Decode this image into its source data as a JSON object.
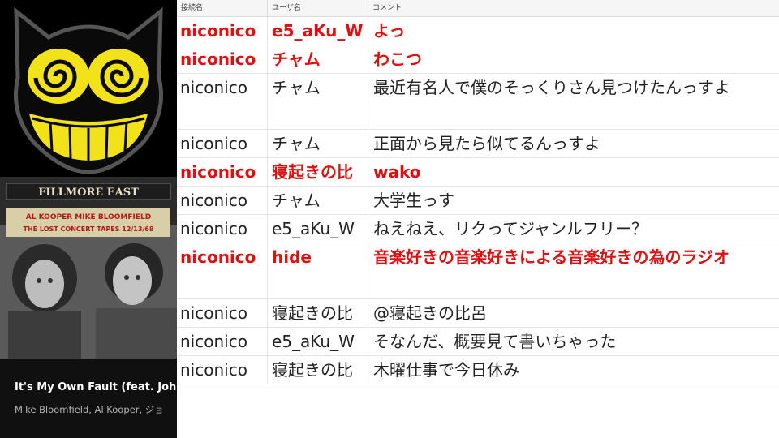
{
  "table": {
    "headers": [
      "接続名",
      "ユーザ名",
      "コメント"
    ],
    "rows": [
      {
        "conn": "niconico",
        "user": "e5_aKu_W",
        "comment": "よっ",
        "highlight": true
      },
      {
        "conn": "niconico",
        "user": "チャム",
        "comment": "わこつ",
        "highlight": true
      },
      {
        "conn": "niconico",
        "user": "チャム",
        "comment": "最近有名人で僕のそっくりさん見つけたんっすよ",
        "highlight": false
      },
      {
        "conn": "niconico",
        "user": "チャム",
        "comment": "正面から見たら似てるんっすよ",
        "highlight": false
      },
      {
        "conn": "niconico",
        "user": "寝起きの比",
        "comment": "wako",
        "highlight": true
      },
      {
        "conn": "niconico",
        "user": "チャム",
        "comment": "大学生っす",
        "highlight": false
      },
      {
        "conn": "niconico",
        "user": "e5_aKu_W",
        "comment": "ねえねえ、リクってジャンルフリー？",
        "highlight": false
      },
      {
        "conn": "niconico",
        "user": "hide",
        "comment": "音楽好きの音楽好きによる音楽好きの為のラジオ",
        "highlight": true
      },
      {
        "conn": "niconico",
        "user": "寝起きの比",
        "comment": "@寝起きの比呂",
        "highlight": false
      },
      {
        "conn": "niconico",
        "user": "e5_aKu_W",
        "comment": "そなんだ、概要見て書いちゃった",
        "highlight": false
      },
      {
        "conn": "niconico",
        "user": "寝起きの比",
        "comment": "木曜仕事で今日休み",
        "highlight": false
      }
    ]
  },
  "now_playing": {
    "title": "It's My Own Fault (feat. John",
    "artist": "Mike Bloomfield, Al Kooper, ジョ",
    "album_marquee": "FILLMORE EAST",
    "album_line1": "AL KOOPER MIKE BLOOMFIELD",
    "album_line2": "THE LOST CONCERT TAPES 12/13/68"
  },
  "colors": {
    "highlight": "#e01010",
    "logo_yellow": "#f2e21a"
  },
  "icons": {
    "logo": "grinning-cat-face-icon",
    "album": "album-art-image"
  }
}
